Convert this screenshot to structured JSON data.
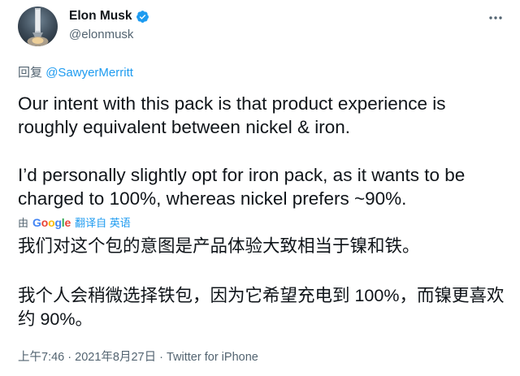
{
  "author": {
    "display_name": "Elon Musk",
    "handle": "@elonmusk",
    "verified_icon": "verified-badge-icon",
    "avatar_icon": "rocket-avatar"
  },
  "more_icon": "more-horizontal-icon",
  "reply": {
    "prefix": "回复",
    "mention": "@SawyerMerritt"
  },
  "tweet": {
    "paragraph_1": "Our intent with this pack is that product experience is roughly equivalent between nickel & iron.",
    "paragraph_2": "I’d personally slightly opt for iron pack, as it wants to be charged to 100%, whereas nickel prefers ~90%."
  },
  "translation": {
    "by_label": "由",
    "provider": "Google",
    "provider_colors": [
      "#4285f4",
      "#ea4335",
      "#fbbc05",
      "#4285f4",
      "#34a853",
      "#ea4335"
    ],
    "link_label": "翻译自 英语",
    "paragraph_1": "我们对这个包的意图是产品体验大致相当于镍和铁。",
    "paragraph_2": "我个人会稍微选择铁包，因为它希望充电到 100%，而镍更喜欢约 90%。"
  },
  "meta": {
    "time": "上午7:46",
    "separator_1": "·",
    "date": "2021年8月27日",
    "separator_2": "·",
    "source": "Twitter for iPhone"
  },
  "colors": {
    "link": "#1d9bf0",
    "text": "#0f1419",
    "secondary": "#536471"
  }
}
